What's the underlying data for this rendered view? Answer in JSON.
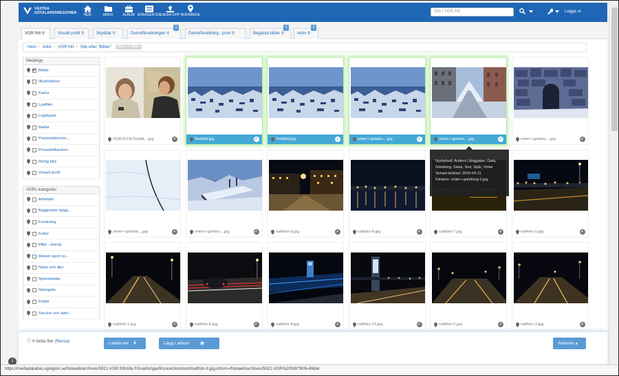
{
  "app": {
    "logo_line1": "VÄSTRA",
    "logo_line2": "GÖTALANDSREGIONEN"
  },
  "nav": [
    {
      "label": "HEM",
      "icon": "home-icon"
    },
    {
      "label": "ARKIV",
      "icon": "folder-icon"
    },
    {
      "label": "ALBUM",
      "icon": "album-icon"
    },
    {
      "label": "SÖKAGENTER",
      "icon": "search-agent-icon"
    },
    {
      "label": "LADDA UPP",
      "icon": "upload-icon"
    },
    {
      "label": "BOKMÄRKE",
      "icon": "bookmark-pin-icon"
    }
  ],
  "search": {
    "placeholder": "Sök i VGR fritt"
  },
  "header": {
    "logout": "Logga ut"
  },
  "tabs": [
    {
      "label": "VGR fritt",
      "badge": ""
    },
    {
      "label": "Visuell profil",
      "badge": ""
    },
    {
      "label": "Skyddat",
      "badge": ""
    },
    {
      "label": "Demoförvaltningen",
      "badge": "1"
    },
    {
      "label": "Demoförvaltning - prod",
      "badge": ""
    },
    {
      "label": "Begärda bilder",
      "badge": "3"
    },
    {
      "label": "Arkiv",
      "badge": "3"
    }
  ],
  "breadcrumb": {
    "items": [
      "Hem",
      "Arkiv",
      "VGR fritt",
      "Sök efter \"Bilder\""
    ],
    "pill": "Bilder ✕ Bilder"
  },
  "sidebar": {
    "media_title": "Medietyp",
    "media_items": [
      {
        "label": "Bilder",
        "checked": true
      },
      {
        "label": "Illustrationer",
        "checked": false
      },
      {
        "label": "Kartor",
        "checked": false
      },
      {
        "label": "Ljudfiler",
        "checked": false
      },
      {
        "label": "Logotyper",
        "checked": false
      },
      {
        "label": "Mallar",
        "checked": false
      },
      {
        "label": "Presentationsm...",
        "checked": false
      },
      {
        "label": "Pressbildbanken",
        "checked": false
      },
      {
        "label": "Rörlig bild",
        "checked": false
      },
      {
        "label": "Visuell profil",
        "checked": false
      }
    ],
    "category_title": "VGRs kategorier",
    "category_items": [
      {
        "label": "Arbetsliv",
        "checked": false
      },
      {
        "label": "Byggnader bygg...",
        "checked": false
      },
      {
        "label": "Forskning",
        "checked": false
      },
      {
        "label": "Kultur",
        "checked": false
      },
      {
        "label": "Miljö - energi",
        "checked": false
      },
      {
        "label": "Motion sport oc...",
        "checked": false
      },
      {
        "label": "Natur och djur",
        "checked": false
      },
      {
        "label": "Nyhetsbilder",
        "checked": false
      },
      {
        "label": "Näringsliv",
        "checked": false
      },
      {
        "label": "Politik",
        "checked": false
      },
      {
        "label": "Service och adm...",
        "checked": false
      }
    ]
  },
  "grid": [
    {
      "name": "VGR16-DETestbil....jpg",
      "selected": false,
      "scene": "office"
    },
    {
      "name": "Testbild.jpg",
      "selected": true,
      "scene": "snowcity"
    },
    {
      "name": "Testbild.jpg",
      "selected": true,
      "scene": "snowcity"
    },
    {
      "name": "vinter-i-gotebo....jpg",
      "selected": true,
      "scene": "snowcity"
    },
    {
      "name": "vinter-i-gotebo....jpg",
      "selected": true,
      "scene": "snowstreet"
    },
    {
      "name": "vinter-i-gotebo....jpg",
      "selected": false,
      "scene": "stonewall"
    },
    {
      "name": "vinter-i-gotebo....jpg",
      "selected": false,
      "scene": "snowfield"
    },
    {
      "name": "vinter-i-gotebo....jpg",
      "selected": false,
      "scene": "snowboat"
    },
    {
      "name": "nattfoto-9.jpg",
      "selected": false,
      "scene": "nightsquare"
    },
    {
      "name": "nattfoto-8.jpg",
      "selected": false,
      "scene": "nightriver"
    },
    {
      "name": "nattfoto-7.jpg",
      "selected": false,
      "scene": "nightriver2"
    },
    {
      "name": "nattfoto-5.jpg",
      "selected": false,
      "scene": "nightroad"
    },
    {
      "name": "nattfoto-1.jpg",
      "selected": false,
      "scene": "nightroad2"
    },
    {
      "name": "nattfoto-6.jpg",
      "selected": false,
      "scene": "nightcar"
    },
    {
      "name": "nattfoto-4.jpg",
      "selected": false,
      "scene": "nightbridge"
    },
    {
      "name": "nattfoto-10.jpg",
      "selected": false,
      "scene": "nightstop"
    },
    {
      "name": "nattfoto-2.jpg",
      "selected": false,
      "scene": "nightroad3"
    },
    {
      "name": "nattfoto-3.jpg",
      "selected": false,
      "scene": "nightroad4"
    }
  ],
  "tooltip": {
    "line1": "Nyckelord: Anders Långgatan, Gata,",
    "line2": "Göteborg, Slask, Snö, Spår, Vinter",
    "line3": "Senast ändrad: 2016-04-11",
    "line4": "Filnamn: vinter-i-goteborg-2.jpg"
  },
  "bottom": {
    "selected_text": "4 Valda filer (",
    "reset": "Rensa",
    "selected_close": ")",
    "download": "Ladda ner",
    "add_album": "Lägg i album",
    "actions": "Aktioner ▴"
  },
  "status_url": "https://mediadatabas.vgregion.se/fotoweb/archives/5021-VGR fritt/Alla Förvaltningar/Koncernkontoret/nattfoto-9.jpg.info#c=/fotoweb/archives/5021-VGR%20fritt/?605=Bilder",
  "colors": {
    "brand": "#1f66b5",
    "selected": "#44a9d6",
    "button": "#5b9bd5"
  }
}
